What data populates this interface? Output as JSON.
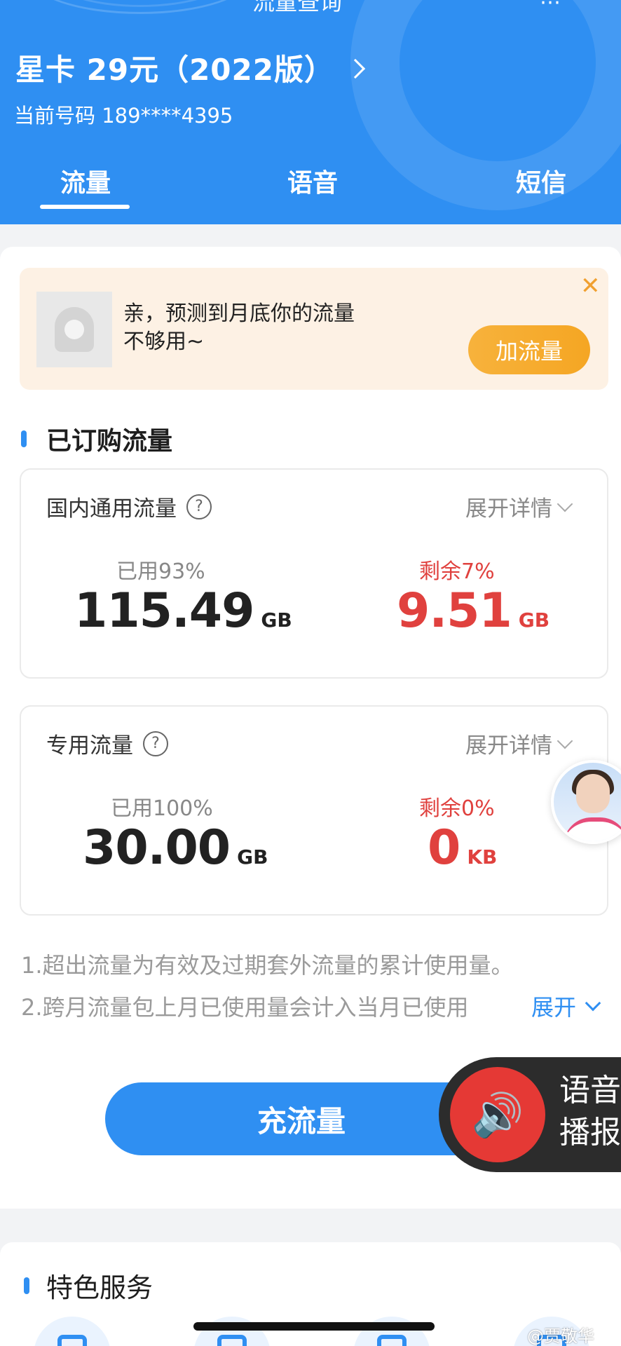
{
  "header": {
    "top_title": "流量查询",
    "plan_name": "星卡 29元（2022版）",
    "phone_number": "当前号码 189****4395",
    "tabs": [
      {
        "label": "流量"
      },
      {
        "label": "语音"
      },
      {
        "label": "短信"
      }
    ],
    "colors": {
      "primary": "#2f8ff2",
      "remain": "#e0413e",
      "warning_button": "#f5a623"
    }
  },
  "notice": {
    "message": "亲，预测到月底你的流量不够用~",
    "close_icon": "close-icon",
    "action_label": "加流量"
  },
  "subscribed": {
    "section_title": "已订购流量",
    "cards": [
      {
        "title": "国内通用流量",
        "help": "?",
        "expand_label": "展开详情",
        "used_label": "已用93%",
        "used_value": "115.49",
        "used_unit": "GB",
        "remain_label": "剩余7%",
        "remain_value": "9.51",
        "remain_unit": "GB",
        "used_percent": 93
      },
      {
        "title": "专用流量",
        "help": "?",
        "expand_label": "展开详情",
        "used_label": "已用100%",
        "used_value": "30.00",
        "used_unit": "GB",
        "remain_label": "剩余0%",
        "remain_value": "0",
        "remain_unit": "KB",
        "used_percent": 100
      }
    ]
  },
  "notes": {
    "line1": "1.超出流量为有效及过期套外流量的累计使用量。",
    "line2": "2.跨月流量包上月已使用量会计入当月已使用",
    "expand_label": "展开"
  },
  "recharge_label": "充流量",
  "voice_widget": {
    "label_line1": "语音",
    "label_line2": "播报",
    "icon": "speaker-icon"
  },
  "featured": {
    "title": "特色服务"
  },
  "watermark": "@贾敬华"
}
